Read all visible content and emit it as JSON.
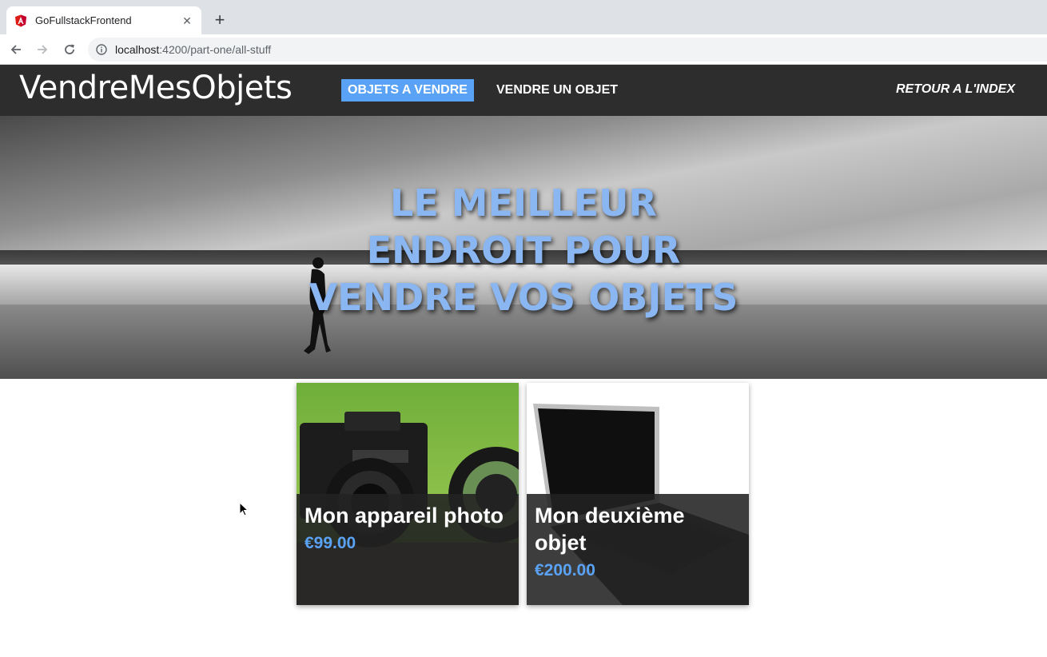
{
  "browser": {
    "tab_title": "GoFullstackFrontend",
    "url_host": "localhost",
    "url_path": ":4200/part-one/all-stuff"
  },
  "header": {
    "brand": "VendreMesObjets",
    "nav": [
      {
        "label": "OBJETS A VENDRE",
        "active": true
      },
      {
        "label": "VENDRE UN OBJET",
        "active": false
      }
    ],
    "right_link": "RETOUR A L'INDEX"
  },
  "hero": {
    "lines": [
      "LE MEILLEUR",
      "ENDROIT POUR",
      "VENDRE VOS OBJETS"
    ]
  },
  "items": [
    {
      "title": "Mon appareil photo",
      "price": "€99.00"
    },
    {
      "title": "Mon deuxième objet",
      "price": "€200.00"
    }
  ],
  "colors": {
    "header_bg": "#2d2d2d",
    "accent": "#5aa2f5",
    "hero_text": "#8ab6f2"
  }
}
